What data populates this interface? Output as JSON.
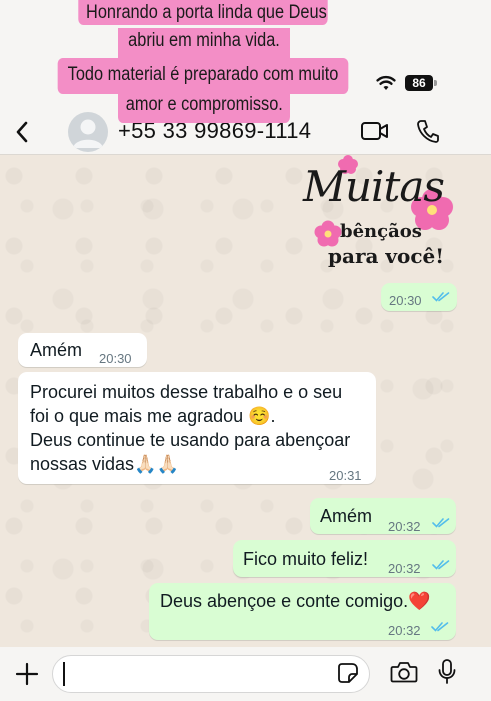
{
  "story_caption": {
    "line1": "Honrando a porta linda que Deus",
    "line2": "abriu em minha vida.",
    "line3": "Todo material é preparado com muito",
    "line4": "amor e compromisso."
  },
  "status_bar": {
    "battery": "86"
  },
  "header": {
    "contact_phone": "+55 33 99869-1114"
  },
  "sticker": {
    "title": "Muitas",
    "line1": "bênçãos",
    "line2": "para você!"
  },
  "messages": [
    {
      "direction": "outgoing",
      "kind": "sticker",
      "time": "20:30",
      "status": "read"
    },
    {
      "direction": "incoming",
      "text": "Amém",
      "time": "20:30"
    },
    {
      "direction": "incoming",
      "lines": [
        "Procurei muitos desse trabalho e o seu",
        "foi o que mais me agradou ☺️.",
        "Deus continue te usando para abençoar",
        "nossas vidas🙏🏻🙏🏻"
      ],
      "time": "20:31"
    },
    {
      "direction": "outgoing",
      "text": "Amém",
      "time": "20:32",
      "status": "read"
    },
    {
      "direction": "outgoing",
      "text": "Fico muito feliz!",
      "time": "20:32",
      "status": "read"
    },
    {
      "direction": "outgoing",
      "text": "Deus abençoe e conte comigo.❤️",
      "time": "20:32",
      "status": "read"
    }
  ],
  "icons": {
    "back": "chevron-left-icon",
    "video": "video-camera-icon",
    "call": "phone-icon",
    "add": "plus-icon",
    "sticker": "sticker-icon",
    "camera": "camera-icon",
    "mic": "microphone-icon",
    "read_receipt": "double-check-icon"
  },
  "colors": {
    "caption_bg": "#f38ec6",
    "outgoing_bubble": "#d9fdd3",
    "incoming_bubble": "#ffffff",
    "wallpaper": "#efe7dd",
    "read_check": "#53bdeb"
  }
}
